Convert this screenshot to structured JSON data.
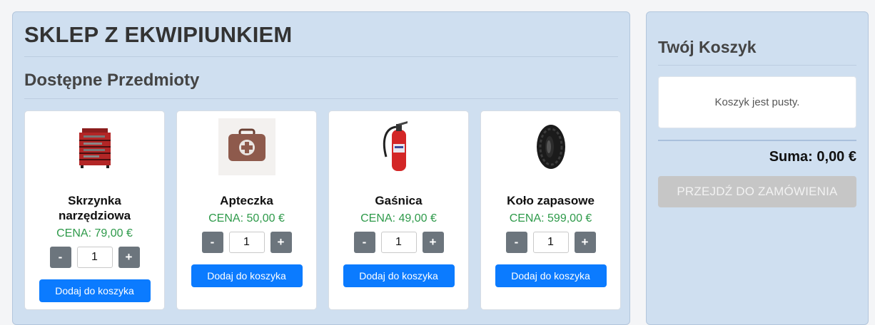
{
  "shop": {
    "title": "SKLEP Z EKWIPIUNKIEM",
    "section_title": "Dostępne Przedmioty",
    "products": [
      {
        "name": "Skrzynka narzędziowa",
        "price": "CENA: 79,00 €",
        "qty": "1",
        "minus": "-",
        "plus": "+",
        "add_label": "Dodaj do koszyka",
        "icon": "toolbox-icon"
      },
      {
        "name": "Apteczka",
        "price": "CENA: 50,00 €",
        "qty": "1",
        "minus": "-",
        "plus": "+",
        "add_label": "Dodaj do koszyka",
        "icon": "first-aid-kit-icon"
      },
      {
        "name": "Gaśnica",
        "price": "CENA: 49,00 €",
        "qty": "1",
        "minus": "-",
        "plus": "+",
        "add_label": "Dodaj do koszyka",
        "icon": "fire-extinguisher-icon"
      },
      {
        "name": "Koło zapasowe",
        "price": "CENA: 599,00 €",
        "qty": "1",
        "minus": "-",
        "plus": "+",
        "add_label": "Dodaj do koszyka",
        "icon": "tire-icon"
      }
    ]
  },
  "cart": {
    "title": "Twój Koszyk",
    "empty_text": "Koszyk jest pusty.",
    "sum": "Suma: 0,00 €",
    "checkout_label": "PRZEJDŹ DO ZAMÓWIENIA"
  },
  "colors": {
    "panel_bg": "#cfdff0",
    "price_green": "#2e9a4a",
    "primary_blue": "#0b7bff",
    "qty_button_gray": "#6c757d",
    "disabled_gray": "#c6c6c6"
  }
}
